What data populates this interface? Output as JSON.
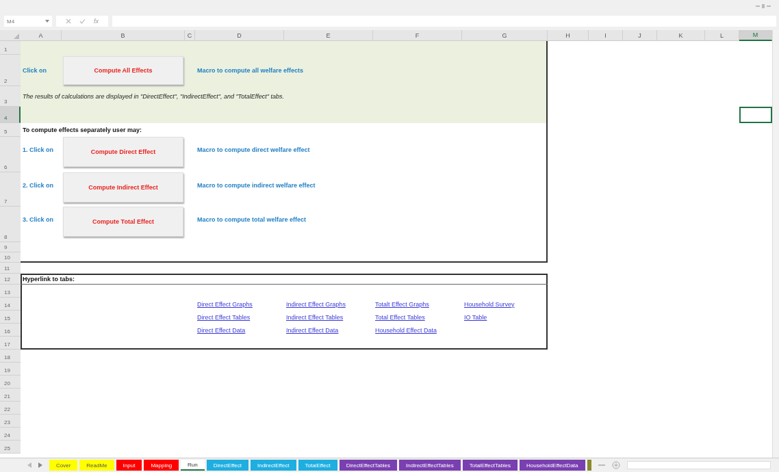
{
  "name_box": "M4",
  "fx": "fx",
  "columns": [
    {
      "label": "A",
      "selected": false
    },
    {
      "label": "B",
      "selected": false
    },
    {
      "label": "C",
      "selected": false
    },
    {
      "label": "D",
      "selected": false
    },
    {
      "label": "E",
      "selected": false
    },
    {
      "label": "F",
      "selected": false
    },
    {
      "label": "G",
      "selected": false
    },
    {
      "label": "H",
      "selected": false
    },
    {
      "label": "I",
      "selected": false
    },
    {
      "label": "J",
      "selected": false
    },
    {
      "label": "K",
      "selected": false
    },
    {
      "label": "L",
      "selected": false
    },
    {
      "label": "M",
      "selected": true
    }
  ],
  "rows": [
    {
      "label": "1",
      "selected": false
    },
    {
      "label": "2",
      "selected": false
    },
    {
      "label": "3",
      "selected": false
    },
    {
      "label": "4",
      "selected": true
    },
    {
      "label": "5",
      "selected": false
    },
    {
      "label": "6",
      "selected": false
    },
    {
      "label": "7",
      "selected": false
    },
    {
      "label": "8",
      "selected": false
    },
    {
      "label": "9",
      "selected": false
    },
    {
      "label": "10",
      "selected": false
    },
    {
      "label": "11",
      "selected": false
    },
    {
      "label": "12",
      "selected": false
    },
    {
      "label": "13",
      "selected": false
    },
    {
      "label": "14",
      "selected": false
    },
    {
      "label": "15",
      "selected": false
    },
    {
      "label": "16",
      "selected": false
    },
    {
      "label": "17",
      "selected": false
    },
    {
      "label": "18",
      "selected": false
    },
    {
      "label": "19",
      "selected": false
    },
    {
      "label": "20",
      "selected": false
    },
    {
      "label": "21",
      "selected": false
    },
    {
      "label": "22",
      "selected": false
    },
    {
      "label": "23",
      "selected": false
    },
    {
      "label": "24",
      "selected": false
    },
    {
      "label": "25",
      "selected": false
    }
  ],
  "sheet": {
    "all": {
      "label": "Click on",
      "button": "Compute All Effects",
      "description": "Macro to compute all welfare effects"
    },
    "note": "The results of calculations are displayed in \"DirectEffect\", \"IndirectEffect\", and \"TotalEffect\" tabs.",
    "separate_heading": "To compute effects separately user may:",
    "steps": [
      {
        "label": "1. Click on",
        "button": "Compute Direct Effect",
        "description": "Macro to compute direct welfare effect"
      },
      {
        "label": "2. Click on",
        "button": "Compute Indirect Effect",
        "description": "Macro to compute indirect welfare effect"
      },
      {
        "label": "3. Click on",
        "button": "Compute Total Effect",
        "description": "Macro to compute total welfare effect"
      }
    ],
    "hyperlink_heading": "Hyperlink to tabs:",
    "link_columns": [
      [
        "Direct Effect Graphs",
        "Direct Effect Tables",
        "Direct Effect Data"
      ],
      [
        "Indirect Effect Graphs",
        "Indirect Effect Tables",
        "Indirect Effect Data"
      ],
      [
        "Totalt Effect Graphs",
        "Total Effect Tables",
        "Household Effect Data"
      ],
      [
        "Household Survey",
        "IO Table"
      ]
    ]
  },
  "sheet_tabs": [
    {
      "label": "Cover",
      "color": "#ffff00",
      "selected": false
    },
    {
      "label": "ReadMe",
      "color": "#ffff00",
      "selected": false
    },
    {
      "label": "Input",
      "color": "#ff0000",
      "selected": false
    },
    {
      "label": "Mapping",
      "color": "#ff0000",
      "selected": false
    },
    {
      "label": "Run",
      "selected": true
    },
    {
      "label": "DirectEffect",
      "color": "#1eaee0",
      "selected": false
    },
    {
      "label": "IndirectEffect",
      "color": "#1eaee0",
      "selected": false
    },
    {
      "label": "TotalEffect",
      "color": "#1eaee0",
      "selected": false
    },
    {
      "label": "DirectEffectTables",
      "color": "#7a3fb0",
      "selected": false
    },
    {
      "label": "IndirectEffectTables",
      "color": "#7a3fb0",
      "selected": false
    },
    {
      "label": "TotalEffectTables",
      "color": "#7a3fb0",
      "selected": false
    },
    {
      "label": "HouseholdEffectData",
      "color": "#7a3fb0",
      "selected": false
    },
    {
      "color": "#8a8a30",
      "selected": false
    }
  ]
}
